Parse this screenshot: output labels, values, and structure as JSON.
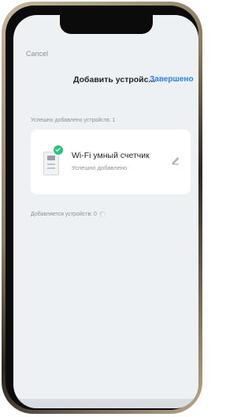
{
  "header": {
    "cancel_label": "Cancel",
    "title": "Добавить устройс...",
    "done_label": "Завершено"
  },
  "summary": {
    "success_text": "Успешно добавлено устройств: 1"
  },
  "device": {
    "name": "Wi-Fi умный счетчик",
    "status": "Успешно добавлено",
    "icon": "smart-meter-icon",
    "badge_icon": "check-icon"
  },
  "progress": {
    "adding_text": "Добавляется устройств: 0"
  },
  "colors": {
    "accent": "#2e7fe6",
    "success": "#2ec27e",
    "background": "#eef1f4"
  }
}
